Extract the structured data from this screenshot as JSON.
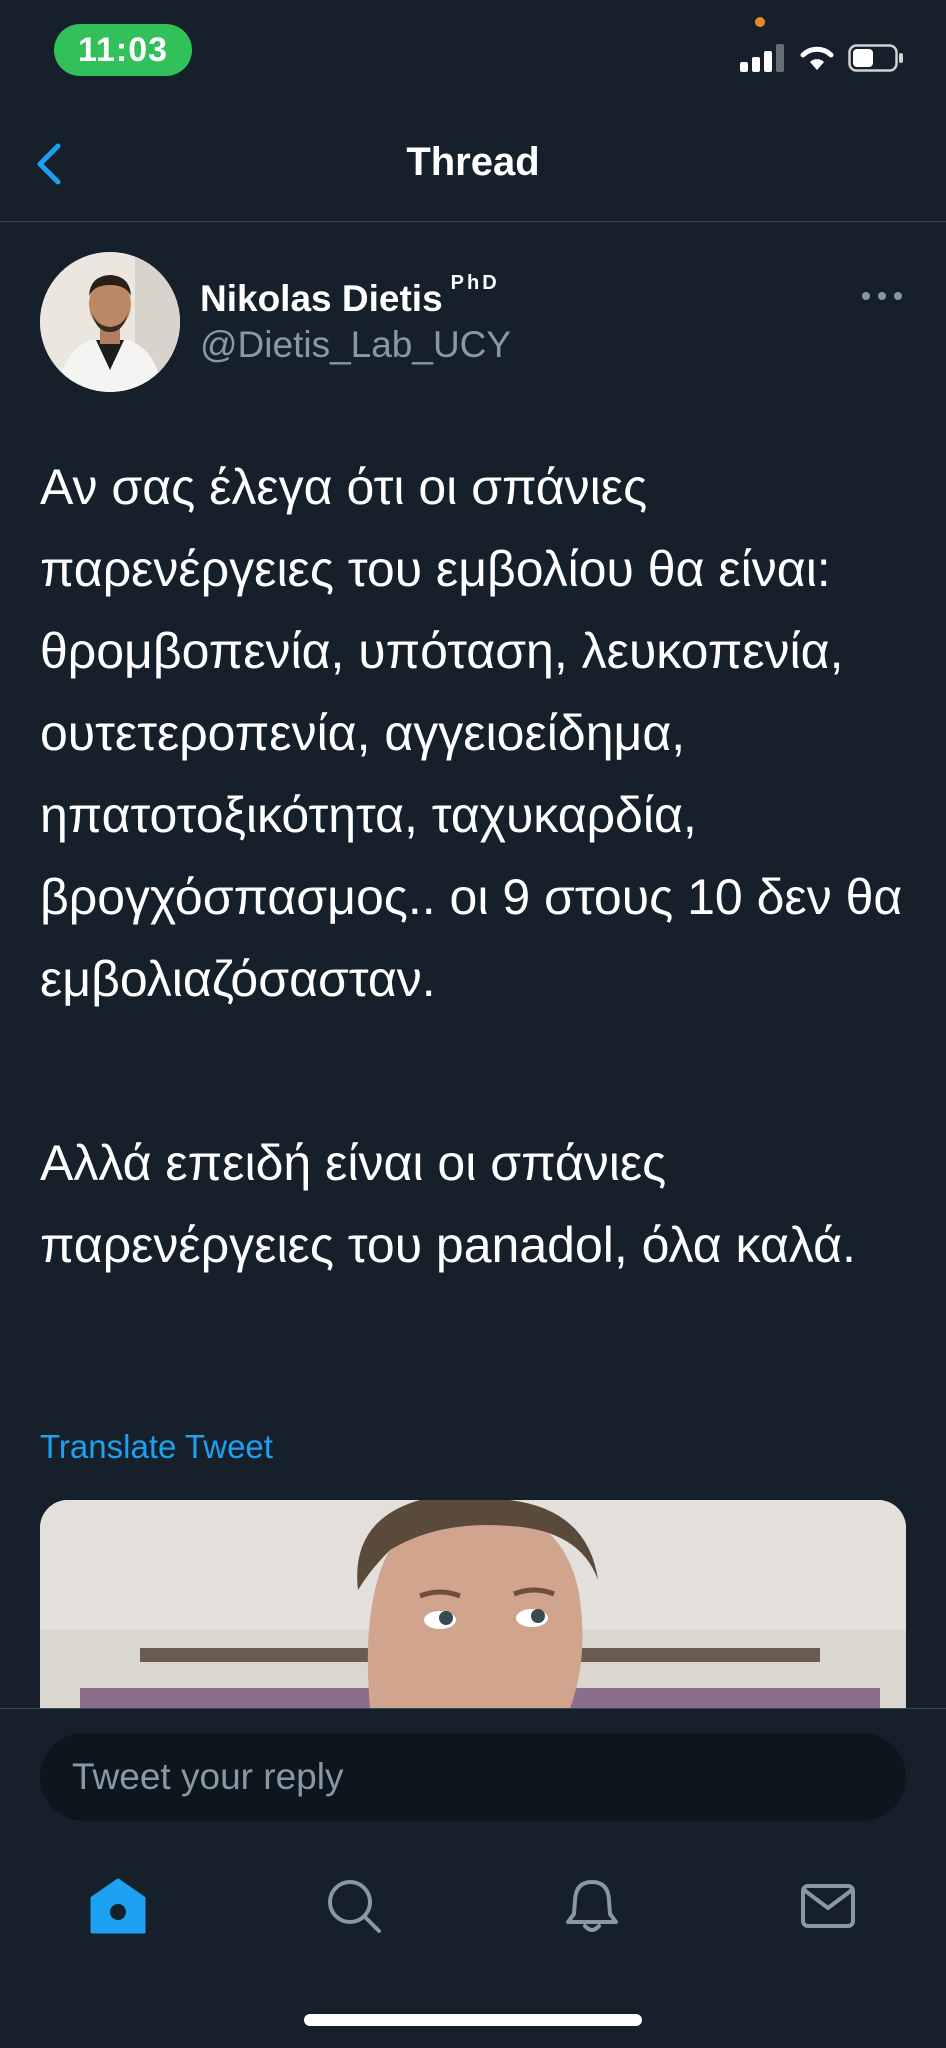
{
  "status_bar": {
    "time": "11:03",
    "icons": [
      "cellular-signal-icon",
      "wifi-icon",
      "battery-icon"
    ]
  },
  "header": {
    "title": "Thread",
    "back_icon": "chevron-left-icon"
  },
  "tweet": {
    "author_name": "Nikolas Dietis",
    "author_suffix": "PhD",
    "handle": "@Dietis_Lab_UCY",
    "paragraphs": [
      "Αν σας έλεγα ότι οι σπάνιες παρενέργειες του εμβολίου θα είναι: θρομβοπενία, υπόταση, λευκοπενία, ουτετεροπενία, αγγειοείδημα, ηπατοτοξικότητα, ταχυκαρδία, βρογχόσπασμος.. οι 9 στους 10 δεν θα εμβολιαζόσασταν.",
      "Αλλά επειδή είναι οι σπάνιες παρενέργειες του panadol, όλα καλά."
    ],
    "translate_label": "Translate Tweet",
    "more_icon": "more-horizontal-icon"
  },
  "reply": {
    "placeholder": "Tweet your reply"
  },
  "tabs": [
    {
      "name": "home",
      "icon": "home-icon",
      "active": true
    },
    {
      "name": "search",
      "icon": "search-icon",
      "active": false
    },
    {
      "name": "notifications",
      "icon": "bell-icon",
      "active": false
    },
    {
      "name": "messages",
      "icon": "mail-icon",
      "active": false
    }
  ],
  "colors": {
    "background": "#15202b",
    "accent": "#1da1f2",
    "secondary_text": "#8899a6",
    "divider": "#38444d",
    "status_time_pill": "#31c05a"
  }
}
